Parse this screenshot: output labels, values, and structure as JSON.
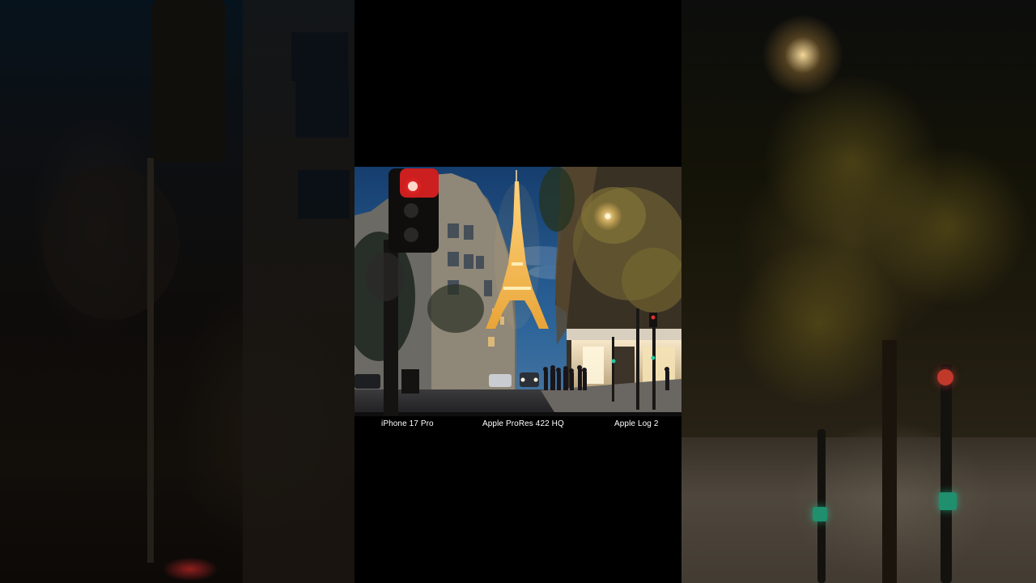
{
  "video": {
    "captions": [
      {
        "label": "iPhone 17 Pro"
      },
      {
        "label": "Apple ProRes 422 HQ"
      },
      {
        "label": "Apple Log 2"
      }
    ]
  },
  "colors": {
    "sky": "#1d4f82",
    "tower_gold": "#f1b54a",
    "signal_red": "#e23030",
    "street_lamp": "#ffd98a"
  }
}
